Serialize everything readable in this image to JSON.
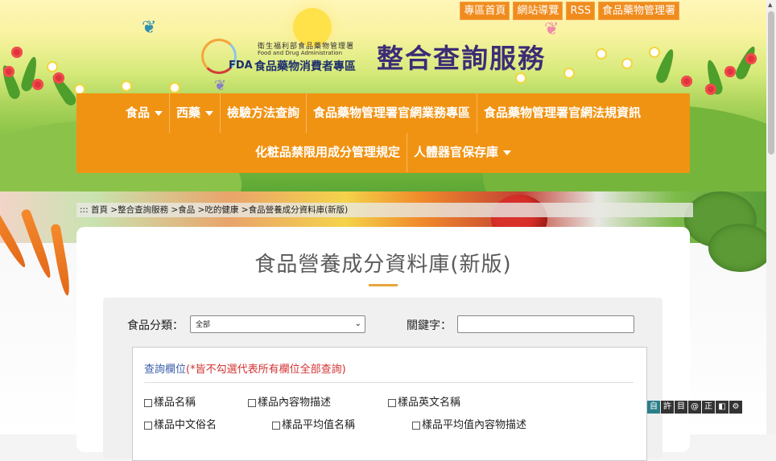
{
  "toplinks": [
    "專區首頁",
    "網站導覽",
    "RSS",
    "食品藥物管理署"
  ],
  "logo": {
    "org": "衛生福利部食品藥物管理署",
    "org_en": "Food and Drug Administration",
    "fda": "FDA",
    "zone": "食品藥物消費者專區"
  },
  "site_title": "整合查詢服務",
  "nav": {
    "row1": [
      "食品",
      "西藥",
      "檢驗方法查詢",
      "食品藥物管理署官網業務專區",
      "食品藥物管理署官網法規資訊"
    ],
    "row2": [
      "化粧品禁限用成分管理規定",
      "人體器官保存庫"
    ]
  },
  "breadcrumb": {
    "prefix": ":::",
    "items": [
      "首頁",
      ">整合查詢服務",
      ">食品",
      ">吃的健康",
      ">食品營養成分資料庫(新版)"
    ]
  },
  "page_title": "食品營養成分資料庫(新版)",
  "search": {
    "category_label": "食品分類：",
    "category_value": "全部",
    "keyword_label": "關鍵字：",
    "keyword_value": ""
  },
  "fields": {
    "heading": "查詢欄位",
    "note": "(*皆不勾選代表所有欄位全部查詢)",
    "row1": [
      "樣品名稱",
      "樣品內容物描述",
      "樣品英文名稱"
    ],
    "row2": [
      "樣品中文俗名",
      "樣品平均值名稱",
      "樣品平均值內容物描述"
    ]
  },
  "a11y": [
    "自",
    "許",
    "目",
    "@",
    "正",
    "◧",
    "⚙"
  ]
}
